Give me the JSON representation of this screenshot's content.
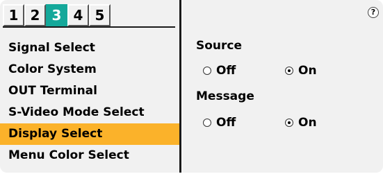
{
  "tabs": [
    "1",
    "2",
    "3",
    "4",
    "5"
  ],
  "active_tab": "3",
  "menu": [
    "Signal Select",
    "Color System",
    "OUT Terminal",
    "S-Video Mode Select",
    "Display Select",
    "Menu Color Select"
  ],
  "selected_menu_item": "Display Select",
  "help_icon_text": "?",
  "source": {
    "label": "Source",
    "off_label": "Off",
    "on_label": "On",
    "selected": "On"
  },
  "message": {
    "label": "Message",
    "off_label": "Off",
    "on_label": "On",
    "selected": "On"
  },
  "colors": {
    "active_tab": "#14a89a",
    "selected_item": "#fbb22a",
    "panel_bg": "#f1f1f1"
  }
}
